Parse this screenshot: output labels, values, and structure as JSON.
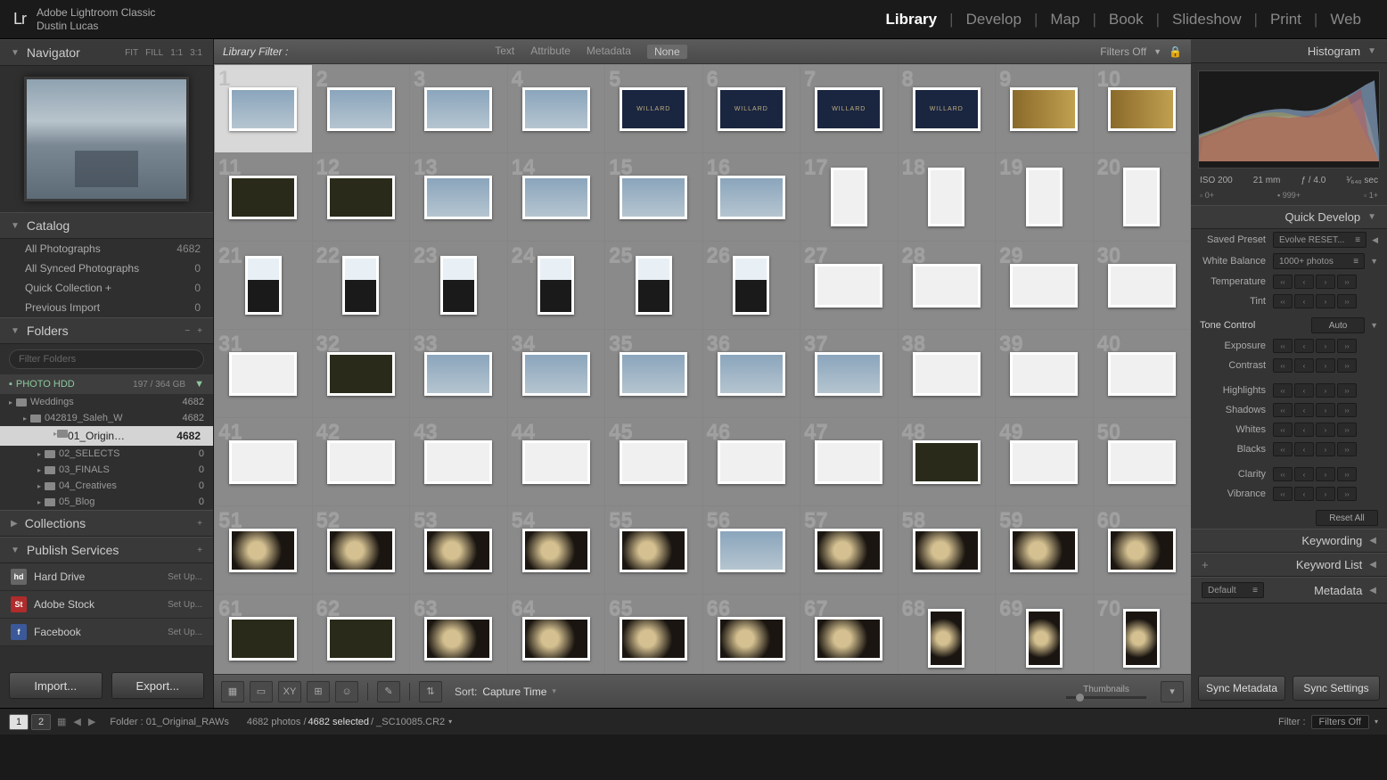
{
  "app": {
    "name": "Adobe Lightroom Classic",
    "user": "Dustin Lucas",
    "logo": "Lr"
  },
  "modules": [
    "Library",
    "Develop",
    "Map",
    "Book",
    "Slideshow",
    "Print",
    "Web"
  ],
  "active_module": "Library",
  "navigator": {
    "title": "Navigator",
    "zoom_presets": [
      "FIT",
      "FILL",
      "1:1",
      "3:1"
    ]
  },
  "catalog": {
    "title": "Catalog",
    "rows": [
      {
        "label": "All Photographs",
        "count": "4682"
      },
      {
        "label": "All Synced Photographs",
        "count": "0"
      },
      {
        "label": "Quick Collection  +",
        "count": "0"
      },
      {
        "label": "Previous Import",
        "count": "0"
      }
    ]
  },
  "folders": {
    "title": "Folders",
    "filter_placeholder": "Filter Folders",
    "drive": {
      "name": "PHOTO HDD",
      "usage": "197 / 364 GB"
    },
    "tree": [
      {
        "indent": 0,
        "name": "Weddings",
        "count": "4682"
      },
      {
        "indent": 1,
        "name": "042819_Saleh_W",
        "count": "4682"
      },
      {
        "indent": 2,
        "name": "01_Origin…",
        "count": "4682",
        "selected": true
      },
      {
        "indent": 2,
        "name": "02_SELECTS",
        "count": "0"
      },
      {
        "indent": 2,
        "name": "03_FINALS",
        "count": "0"
      },
      {
        "indent": 2,
        "name": "04_Creatives",
        "count": "0"
      },
      {
        "indent": 2,
        "name": "05_Blog",
        "count": "0"
      }
    ]
  },
  "collections": {
    "title": "Collections"
  },
  "publish": {
    "title": "Publish Services",
    "services": [
      {
        "name": "Hard Drive",
        "action": "Set Up...",
        "icon": "hd",
        "bg": "#666",
        "fg": "#fff"
      },
      {
        "name": "Adobe Stock",
        "action": "Set Up...",
        "icon": "St",
        "bg": "#b02b2b",
        "fg": "#fff"
      },
      {
        "name": "Facebook",
        "action": "Set Up...",
        "icon": "f",
        "bg": "#3b5998",
        "fg": "#fff"
      }
    ]
  },
  "left_buttons": {
    "import": "Import...",
    "export": "Export..."
  },
  "filter_bar": {
    "label": "Library Filter :",
    "tabs": [
      "Text",
      "Attribute",
      "Metadata",
      "None"
    ],
    "selected": "None",
    "filters_off": "Filters Off"
  },
  "grid": {
    "count": 70,
    "selected_index": 0,
    "types": [
      "blue",
      "blue",
      "blue",
      "blue",
      "sign",
      "sign",
      "sign",
      "sign",
      "gold",
      "gold",
      "dark",
      "dark",
      "blue",
      "blue",
      "blue",
      "blue",
      "white",
      "white",
      "white",
      "white",
      "sil",
      "sil",
      "sil",
      "sil",
      "sil",
      "sil",
      "white",
      "white",
      "white",
      "white",
      "white",
      "dark",
      "blue",
      "blue",
      "blue",
      "blue",
      "blue",
      "white",
      "white",
      "white",
      "white",
      "white",
      "white",
      "white",
      "white",
      "white",
      "white",
      "dark",
      "white",
      "white",
      "ring",
      "ring",
      "ring",
      "ring",
      "ring",
      "blue",
      "ring",
      "ring",
      "ring",
      "ring",
      "dark",
      "dark",
      "ring",
      "ring",
      "ring",
      "ring",
      "ring",
      "ring",
      "ring",
      "ring"
    ],
    "portrait_rows": [
      1,
      2,
      5,
      6
    ]
  },
  "toolbar": {
    "sort_label": "Sort:",
    "sort_value": "Capture Time",
    "thumb_label": "Thumbnails"
  },
  "histogram": {
    "title": "Histogram",
    "iso": "ISO 200",
    "focal": "21 mm",
    "aperture": "ƒ / 4.0",
    "shutter": "¹⁄₆₄₀ sec",
    "flag_left": "0+",
    "flag_mid": "999+",
    "flag_right": "1+"
  },
  "quick_develop": {
    "title": "Quick Develop",
    "preset_label": "Saved Preset",
    "preset_value": "Evolve RESET...",
    "wb_label": "White Balance",
    "wb_value": "1000+ photos",
    "tone_label": "Tone Control",
    "auto": "Auto",
    "sliders": [
      "Temperature",
      "Tint",
      "Exposure",
      "Contrast",
      "Highlights",
      "Shadows",
      "Whites",
      "Blacks",
      "Clarity",
      "Vibrance"
    ],
    "reset": "Reset All"
  },
  "right_sections": {
    "keywording": "Keywording",
    "keyword_list": "Keyword List",
    "metadata": "Metadata",
    "metadata_preset": "Default"
  },
  "sync": {
    "meta": "Sync Metadata",
    "settings": "Sync Settings"
  },
  "status": {
    "pages": [
      "1",
      "2"
    ],
    "folder_label": "Folder : 01_Original_RAWs",
    "counts": "4682 photos /",
    "selected": "4682 selected",
    "filename": "/ _SC10085.CR2",
    "filter_label": "Filter :",
    "filter_value": "Filters Off"
  }
}
